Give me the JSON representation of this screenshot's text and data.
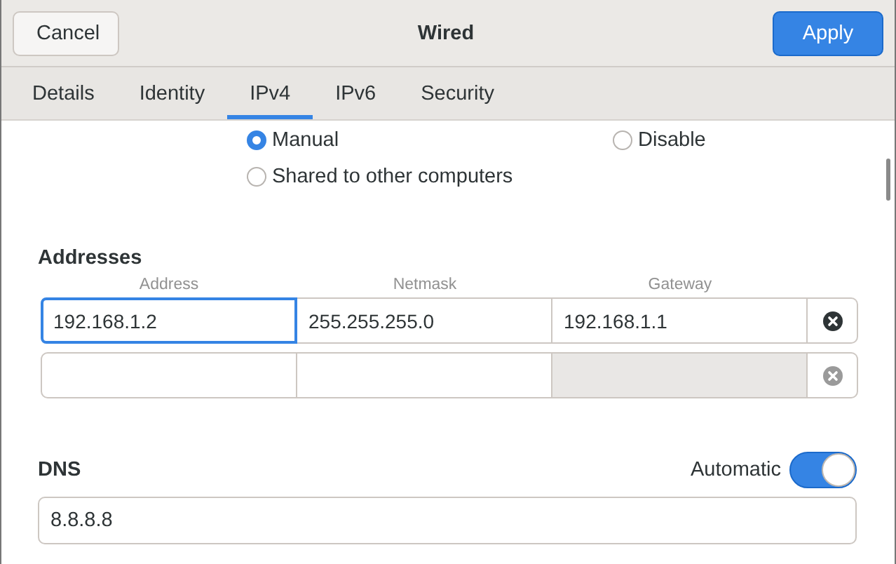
{
  "window": {
    "title": "Wired"
  },
  "header_buttons": [
    {
      "label": "Cancel",
      "kind": "plain"
    },
    {
      "label": "Apply",
      "kind": "suggested"
    }
  ],
  "tabs": [
    {
      "label": "Details",
      "selected": false
    },
    {
      "label": "Identity",
      "selected": false
    },
    {
      "label": "IPv4",
      "selected": true
    },
    {
      "label": "IPv6",
      "selected": false
    },
    {
      "label": "Security",
      "selected": false
    }
  ],
  "method": [
    {
      "label": "Manual",
      "selected": true
    },
    {
      "label": "Disable",
      "selected": false
    },
    {
      "label": "Shared to other computers",
      "selected": false
    }
  ],
  "addresses": {
    "heading": "Addresses",
    "columns": [
      "Address",
      "Netmask",
      "Gateway"
    ],
    "rows": [
      {
        "cells": [
          {
            "value": "192.168.1.2",
            "focused": true,
            "disabled": false
          },
          {
            "value": "255.255.255.0",
            "focused": false,
            "disabled": false
          },
          {
            "value": "192.168.1.1",
            "focused": false,
            "disabled": false
          }
        ],
        "remove_disabled": false
      },
      {
        "cells": [
          {
            "focused": false,
            "disabled": false
          },
          {
            "focused": false,
            "disabled": false
          },
          {
            "focused": false,
            "disabled": true
          }
        ],
        "remove_disabled": true
      }
    ]
  },
  "dns": {
    "heading": "DNS",
    "automatic_label": "Automatic",
    "automatic": true,
    "servers": "8.8.8.8"
  }
}
